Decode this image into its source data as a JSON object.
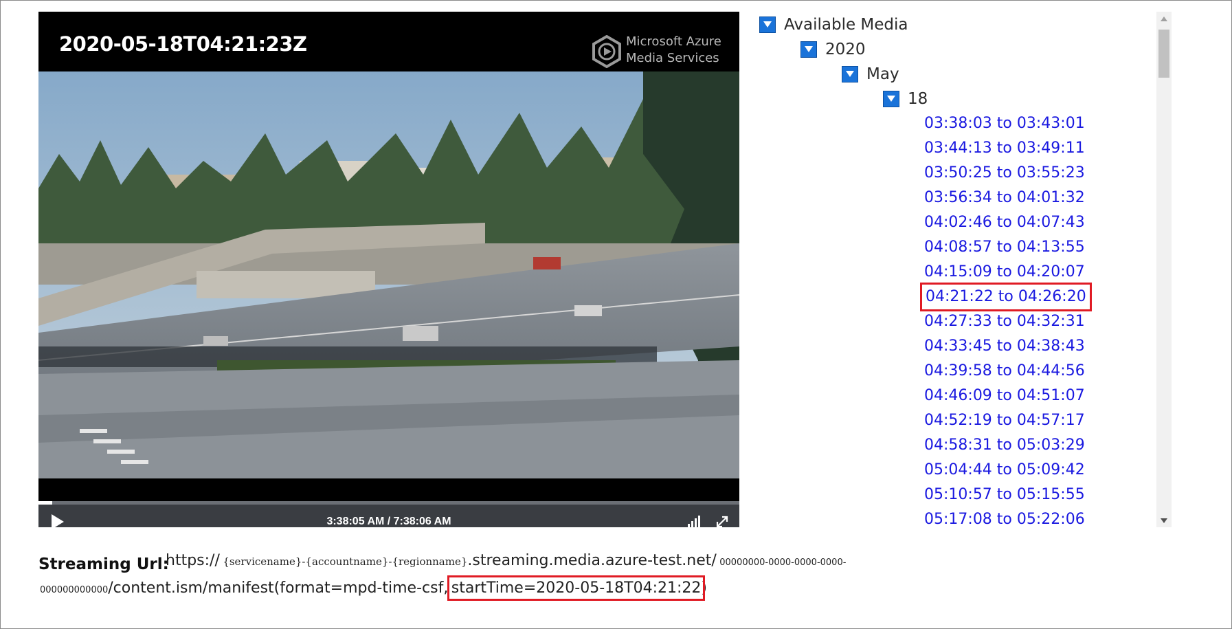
{
  "player": {
    "timestamp": "2020-05-18T04:21:23Z",
    "brand_line1": "Microsoft Azure",
    "brand_line2": "Media Services",
    "time_display": "3:38:05 AM / 7:38:06 AM",
    "progress": 0.005,
    "icons": {
      "play": "play-icon",
      "quality": "signal-bars-icon",
      "fullscreen": "expand-icon"
    }
  },
  "tree": {
    "root": "Available Media",
    "year": "2020",
    "month": "May",
    "day": "18",
    "ranges": [
      "03:38:03 to 03:43:01",
      "03:44:13 to 03:49:11",
      "03:50:25 to 03:55:23",
      "03:56:34 to 04:01:32",
      "04:02:46 to 04:07:43",
      "04:08:57 to 04:13:55",
      "04:15:09 to 04:20:07",
      "04:21:22 to 04:26:20",
      "04:27:33 to 04:32:31",
      "04:33:45 to 04:38:43",
      "04:39:58 to 04:44:56",
      "04:46:09 to 04:51:07",
      "04:52:19 to 04:57:17",
      "04:58:31 to 05:03:29",
      "05:04:44 to 05:09:42",
      "05:10:57 to 05:15:55",
      "05:17:08 to 05:22:06"
    ],
    "selected_index": 7
  },
  "streaming": {
    "label": "Streaming Url:",
    "part_scheme": "https://",
    "part_service": "{servicename}-{accountname}-{regionname}",
    "part_host": ".streaming.media.azure-test.net/",
    "part_guid1": "00000000-0000-0000-0000-",
    "part_guid2": "000000000000",
    "part_path": "/content.ism/manifest(format=mpd-time-csf,",
    "part_start": "startTime=2020-05-18T04:21:22",
    "part_close": ")"
  }
}
